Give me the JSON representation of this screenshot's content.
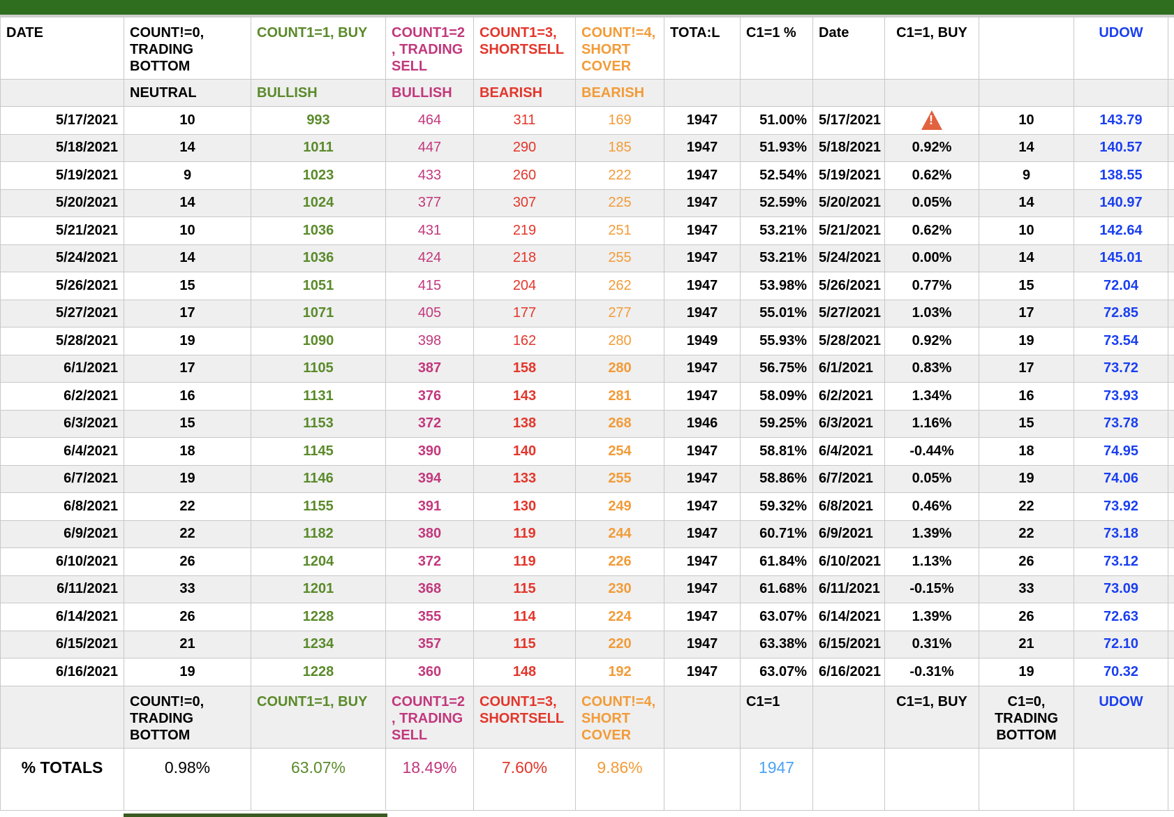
{
  "header": {
    "date": "DATE",
    "c0": "COUNT!=0, TRADING BOTTOM",
    "c1": "COUNT1=1, BUY",
    "c2": "COUNT1=2 , TRADING SELL",
    "c3": "COUNT1=3, SHORTSELL",
    "c4": "COUNT!=4, SHORT COVER",
    "total": "TOTA:L",
    "pct": "C1=1 %",
    "date2": "Date",
    "buy": "C1=1, BUY",
    "blank": "",
    "udow": "UDOW"
  },
  "subheader": {
    "c0": "NEUTRAL",
    "c1": "BULLISH",
    "c2": "BULLISH",
    "c3": "BEARISH",
    "c4": "BEARISH"
  },
  "rows": [
    [
      "5/17/2021",
      "10",
      "993",
      "464",
      "311",
      "169",
      "1947",
      "51.00%",
      "5/17/2021",
      "warning-icon",
      "10",
      "143.79"
    ],
    [
      "5/18/2021",
      "14",
      "1011",
      "447",
      "290",
      "185",
      "1947",
      "51.93%",
      "5/18/2021",
      "0.92%",
      "14",
      "140.57"
    ],
    [
      "5/19/2021",
      "9",
      "1023",
      "433",
      "260",
      "222",
      "1947",
      "52.54%",
      "5/19/2021",
      "0.62%",
      "9",
      "138.55"
    ],
    [
      "5/20/2021",
      "14",
      "1024",
      "377",
      "307",
      "225",
      "1947",
      "52.59%",
      "5/20/2021",
      "0.05%",
      "14",
      "140.97"
    ],
    [
      "5/21/2021",
      "10",
      "1036",
      "431",
      "219",
      "251",
      "1947",
      "53.21%",
      "5/21/2021",
      "0.62%",
      "10",
      "142.64"
    ],
    [
      "5/24/2021",
      "14",
      "1036",
      "424",
      "218",
      "255",
      "1947",
      "53.21%",
      "5/24/2021",
      "0.00%",
      "14",
      "145.01"
    ],
    [
      "5/26/2021",
      "15",
      "1051",
      "415",
      "204",
      "262",
      "1947",
      "53.98%",
      "5/26/2021",
      "0.77%",
      "15",
      "72.04"
    ],
    [
      "5/27/2021",
      "17",
      "1071",
      "405",
      "177",
      "277",
      "1947",
      "55.01%",
      "5/27/2021",
      "1.03%",
      "17",
      "72.85"
    ],
    [
      "5/28/2021",
      "19",
      "1090",
      "398",
      "162",
      "280",
      "1949",
      "55.93%",
      "5/28/2021",
      "0.92%",
      "19",
      "73.54"
    ],
    [
      "6/1/2021",
      "17",
      "1105",
      "387",
      "158",
      "280",
      "1947",
      "56.75%",
      "6/1/2021",
      "0.83%",
      "17",
      "73.72"
    ],
    [
      "6/2/2021",
      "16",
      "1131",
      "376",
      "143",
      "281",
      "1947",
      "58.09%",
      "6/2/2021",
      "1.34%",
      "16",
      "73.93"
    ],
    [
      "6/3/2021",
      "15",
      "1153",
      "372",
      "138",
      "268",
      "1946",
      "59.25%",
      "6/3/2021",
      "1.16%",
      "15",
      "73.78"
    ],
    [
      "6/4/2021",
      "18",
      "1145",
      "390",
      "140",
      "254",
      "1947",
      "58.81%",
      "6/4/2021",
      "-0.44%",
      "18",
      "74.95"
    ],
    [
      "6/7/2021",
      "19",
      "1146",
      "394",
      "133",
      "255",
      "1947",
      "58.86%",
      "6/7/2021",
      "0.05%",
      "19",
      "74.06"
    ],
    [
      "6/8/2021",
      "22",
      "1155",
      "391",
      "130",
      "249",
      "1947",
      "59.32%",
      "6/8/2021",
      "0.46%",
      "22",
      "73.92"
    ],
    [
      "6/9/2021",
      "22",
      "1182",
      "380",
      "119",
      "244",
      "1947",
      "60.71%",
      "6/9/2021",
      "1.39%",
      "22",
      "73.18"
    ],
    [
      "6/10/2021",
      "26",
      "1204",
      "372",
      "119",
      "226",
      "1947",
      "61.84%",
      "6/10/2021",
      "1.13%",
      "26",
      "73.12"
    ],
    [
      "6/11/2021",
      "33",
      "1201",
      "368",
      "115",
      "230",
      "1947",
      "61.68%",
      "6/11/2021",
      "-0.15%",
      "33",
      "73.09"
    ],
    [
      "6/14/2021",
      "26",
      "1228",
      "355",
      "114",
      "224",
      "1947",
      "63.07%",
      "6/14/2021",
      "1.39%",
      "26",
      "72.63"
    ],
    [
      "6/15/2021",
      "21",
      "1234",
      "357",
      "115",
      "220",
      "1947",
      "63.38%",
      "6/15/2021",
      "0.31%",
      "21",
      "72.10"
    ],
    [
      "6/16/2021",
      "19",
      "1228",
      "360",
      "148",
      "192",
      "1947",
      "63.07%",
      "6/16/2021",
      "-0.31%",
      "19",
      "70.32"
    ]
  ],
  "footer_header": {
    "c0": "COUNT!=0, TRADING BOTTOM",
    "c1": "COUNT1=1, BUY",
    "c2": "COUNT1=2 , TRADING SELL",
    "c3": "COUNT1=3, SHORTSELL",
    "c4": "COUNT!=4, SHORT COVER",
    "pct": "C1=1",
    "buy": "C1=1, BUY",
    "c0b": "C1=0, TRADING BOTTOM",
    "udow": "UDOW"
  },
  "totals": {
    "label": "% TOTALS",
    "c0": "0.98%",
    "c1": "63.07%",
    "c2": "18.49%",
    "c3": "7.60%",
    "c4": "9.86%",
    "pct": "1947"
  }
}
